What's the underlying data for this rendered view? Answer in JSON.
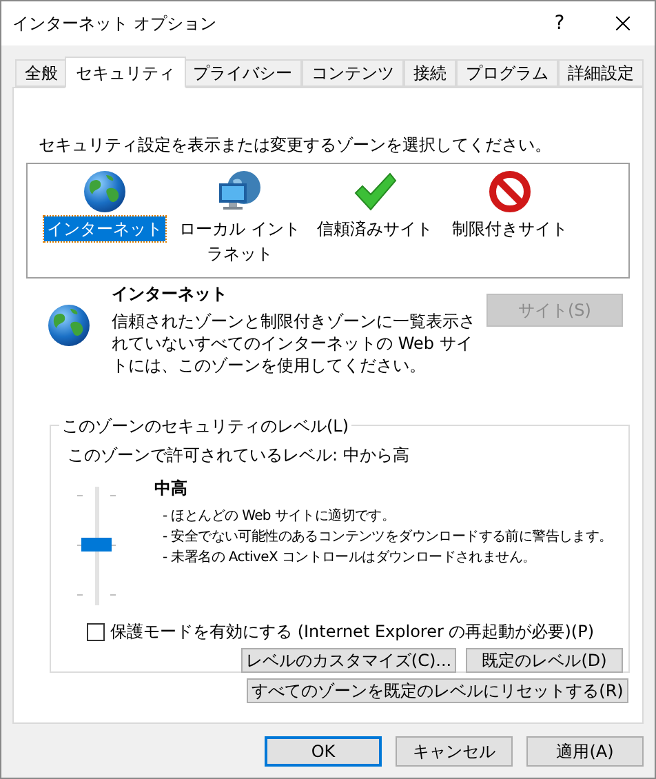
{
  "window": {
    "title": "インターネット オプション",
    "help": "?"
  },
  "tabs": [
    {
      "label": "全般",
      "selected": false
    },
    {
      "label": "セキュリティ",
      "selected": true
    },
    {
      "label": "プライバシー",
      "selected": false
    },
    {
      "label": "コンテンツ",
      "selected": false
    },
    {
      "label": "接続",
      "selected": false
    },
    {
      "label": "プログラム",
      "selected": false
    },
    {
      "label": "詳細設定",
      "selected": false
    }
  ],
  "zone_prompt": "セキュリティ設定を表示または変更するゾーンを選択してください。",
  "zones": [
    {
      "label": "インターネット",
      "kind": "globe",
      "selected": true
    },
    {
      "label": "ローカル イントラネット",
      "kind": "intranet",
      "selected": false
    },
    {
      "label": "信頼済みサイト",
      "kind": "trusted",
      "selected": false
    },
    {
      "label": "制限付きサイト",
      "kind": "restricted",
      "selected": false
    }
  ],
  "zone_detail": {
    "kind": "globe",
    "title": "インターネット",
    "description": "信頼されたゾーンと制限付きゾーンに一覧表示されていないすべてのインターネットの Web サイトには、このゾーンを使用してください。",
    "sites_button": {
      "label": "サイト(S)",
      "disabled": true
    }
  },
  "security_level": {
    "legend": "このゾーンのセキュリティのレベル(L)",
    "allowed": "このゾーンで許可されているレベル: 中から高",
    "slider": {
      "level": 0.5
    },
    "level_name": "中高",
    "bullets": [
      "- ほとんどの Web サイトに適切です。",
      "- 安全でない可能性のあるコンテンツをダウンロードする前に警告します。",
      "- 未署名の ActiveX コントロールはダウンロードされません。"
    ],
    "protected_mode": {
      "label": "保護モードを有効にする (Internet Explorer の再起動が必要)(P)",
      "checked": false
    },
    "buttons": [
      "レベルのカスタマイズ(C)...",
      "既定のレベル(D)"
    ]
  },
  "reset_button": "すべてのゾーンを既定のレベルにリセットする(R)",
  "dialog_buttons": [
    {
      "label": "OK",
      "default": true
    },
    {
      "label": "キャンセル",
      "default": false
    },
    {
      "label": "適用(A)",
      "default": false
    }
  ]
}
